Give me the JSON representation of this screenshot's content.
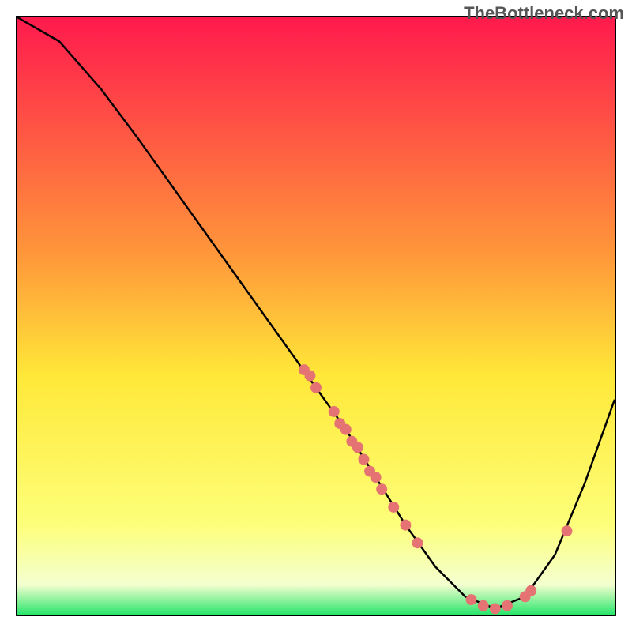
{
  "watermark": "TheBottleneck.com",
  "chart_data": {
    "type": "line",
    "title": "",
    "xlabel": "",
    "ylabel": "",
    "xlim": [
      0,
      100
    ],
    "ylim": [
      0,
      100
    ],
    "curve": [
      {
        "x": 0,
        "y": 100
      },
      {
        "x": 7,
        "y": 96
      },
      {
        "x": 14,
        "y": 88
      },
      {
        "x": 20,
        "y": 80
      },
      {
        "x": 30,
        "y": 66
      },
      {
        "x": 40,
        "y": 52
      },
      {
        "x": 50,
        "y": 38
      },
      {
        "x": 55,
        "y": 31
      },
      {
        "x": 60,
        "y": 23
      },
      {
        "x": 65,
        "y": 15
      },
      {
        "x": 70,
        "y": 8
      },
      {
        "x": 75,
        "y": 3
      },
      {
        "x": 80,
        "y": 1
      },
      {
        "x": 85,
        "y": 3
      },
      {
        "x": 90,
        "y": 10
      },
      {
        "x": 95,
        "y": 22
      },
      {
        "x": 100,
        "y": 36
      }
    ],
    "markers": [
      {
        "x": 48,
        "y": 41
      },
      {
        "x": 49,
        "y": 40
      },
      {
        "x": 50,
        "y": 38
      },
      {
        "x": 53,
        "y": 34
      },
      {
        "x": 54,
        "y": 32
      },
      {
        "x": 55,
        "y": 31
      },
      {
        "x": 56,
        "y": 29
      },
      {
        "x": 57,
        "y": 28
      },
      {
        "x": 58,
        "y": 26
      },
      {
        "x": 59,
        "y": 24
      },
      {
        "x": 60,
        "y": 23
      },
      {
        "x": 61,
        "y": 21
      },
      {
        "x": 63,
        "y": 18
      },
      {
        "x": 65,
        "y": 15
      },
      {
        "x": 67,
        "y": 12
      },
      {
        "x": 76,
        "y": 2.5
      },
      {
        "x": 78,
        "y": 1.5
      },
      {
        "x": 80,
        "y": 1
      },
      {
        "x": 82,
        "y": 1.5
      },
      {
        "x": 85,
        "y": 3
      },
      {
        "x": 86,
        "y": 4
      },
      {
        "x": 92,
        "y": 14
      }
    ],
    "gradient_stops": [
      {
        "offset": 0,
        "color": "#ff1a4d"
      },
      {
        "offset": 40,
        "color": "#ff983a"
      },
      {
        "offset": 60,
        "color": "#ffe838"
      },
      {
        "offset": 85,
        "color": "#fdff7a"
      },
      {
        "offset": 95,
        "color": "#f4ffd0"
      },
      {
        "offset": 100,
        "color": "#29e56b"
      }
    ],
    "marker_color": "#e57373",
    "curve_color": "#000000"
  }
}
